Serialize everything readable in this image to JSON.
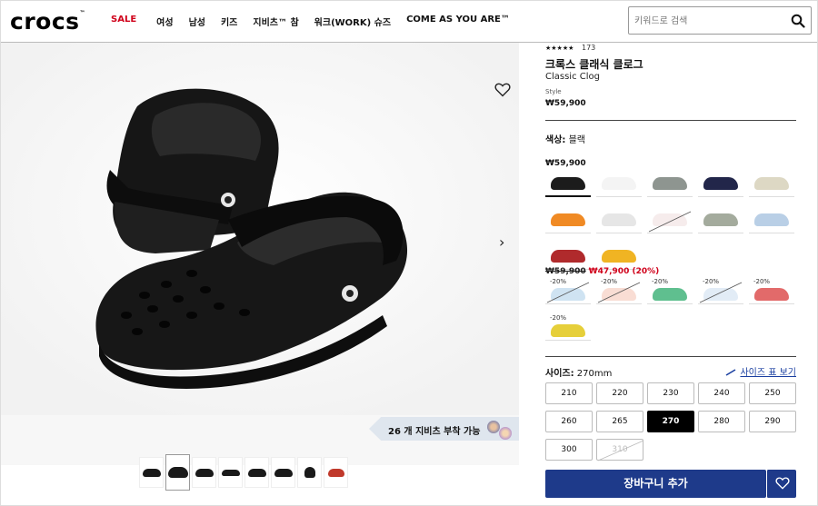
{
  "header": {
    "logo": "crocs",
    "logo_mark": "™",
    "nav": [
      "SALE",
      "여성",
      "남성",
      "키즈",
      "지비츠™ 참",
      "워크(WORK) 슈즈",
      "COME AS YOU ARE™"
    ],
    "search_placeholder": "키워드로 검색",
    "search_icon": "search-icon"
  },
  "gallery": {
    "jibbitz_badge": "26 개 지비츠 부착 가능",
    "thumbnail_count": 8,
    "active_thumbnail": 2
  },
  "product": {
    "rating_count": "173",
    "rating_stars": 5,
    "name_ko": "크록스 클래식 클로그",
    "name_en": "Classic Clog",
    "style_label": "Style",
    "price": "₩59,900",
    "color_label": "색상:",
    "color_value": "블랙",
    "regular_price": "₩59,900",
    "sale_old_price": "₩59,900",
    "sale_new_price": "₩47,900 (20%)",
    "discount_tag": "-20%",
    "size_label": "사이즈:",
    "size_value": "270mm",
    "size_guide": "사이즈 표 보기",
    "sizes": [
      "210",
      "220",
      "230",
      "240",
      "250",
      "260",
      "265",
      "270",
      "280",
      "290",
      "300",
      "310"
    ],
    "selected_size": "270",
    "unavailable_size": "310",
    "cart_button": "장바구니 추가"
  },
  "colors": {
    "regular": [
      "#1c1c1c",
      "#f4f4f4",
      "#8e9590",
      "#22264a",
      "#ddd8c4",
      "#f08a24",
      "#e6e6e6",
      "#f6ecec",
      "#a4ab9d",
      "#b9cfe6",
      "#b02a2c",
      "#f0b423"
    ],
    "sale": [
      "#cfe3f2",
      "#f9ddd4",
      "#5fbf8f",
      "#e2ecf6",
      "#e26a6a",
      "#e6cf3a"
    ],
    "accent": "#1e3a8a",
    "sale_red": "#d0021b"
  }
}
